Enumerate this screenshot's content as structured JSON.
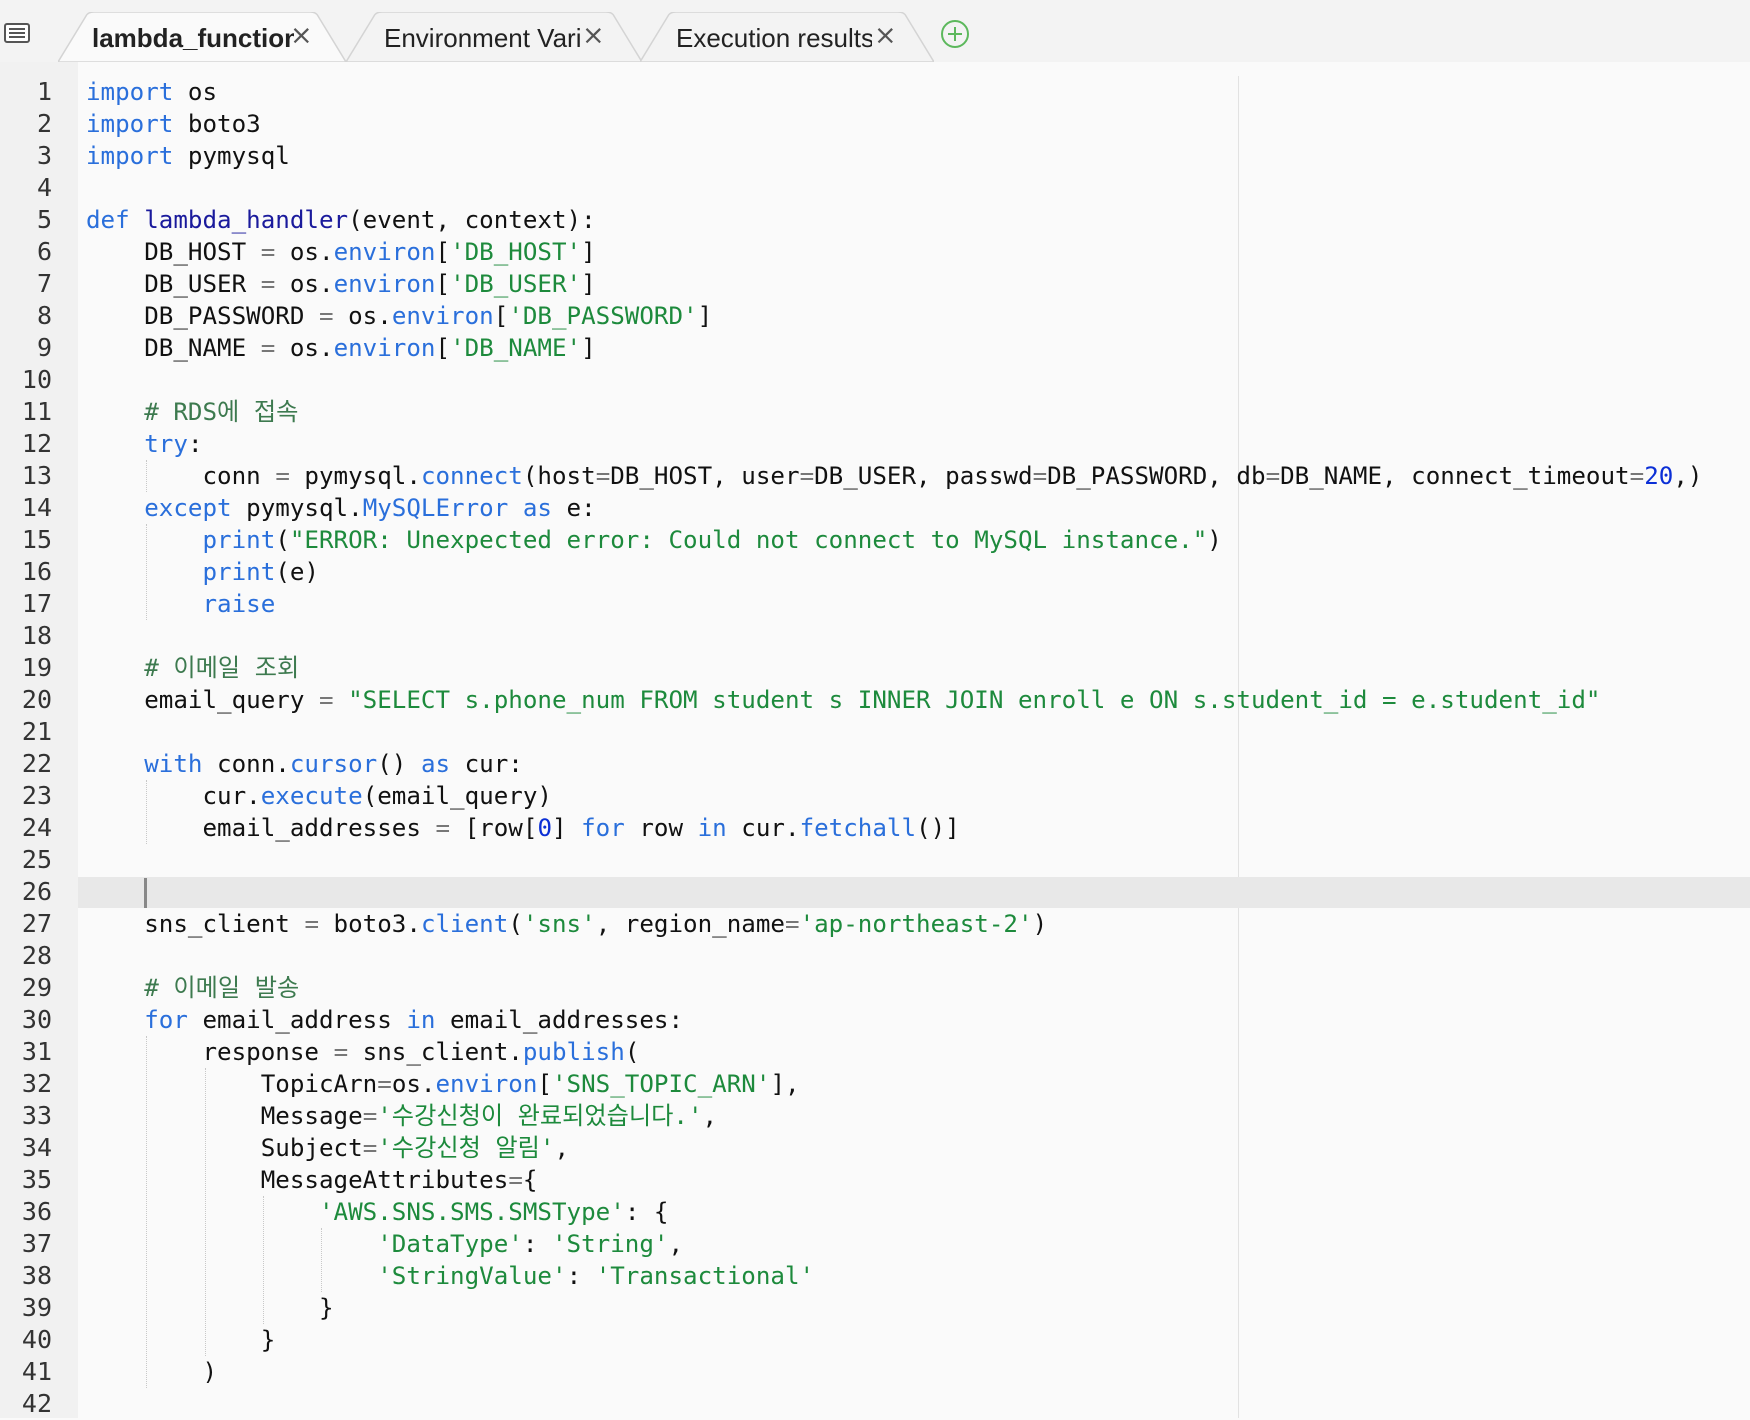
{
  "tabs": [
    {
      "label": "lambda_function",
      "active": true
    },
    {
      "label": "Environment Vari",
      "active": false
    },
    {
      "label": "Execution results",
      "active": false
    }
  ],
  "icons": {
    "menu": "list-menu-icon",
    "close": "close-icon",
    "add_tab": "plus-circle-icon"
  },
  "colors": {
    "keyword": "#2a6fdb",
    "function": "#1a1a9c",
    "string": "#1d8a3c",
    "comment": "#3d7a4f",
    "number": "#0b2fd6",
    "add_tab": "#5cb85c"
  },
  "editor": {
    "language": "python",
    "active_line": 26,
    "line_numbers": [
      "1",
      "2",
      "3",
      "4",
      "5",
      "6",
      "7",
      "8",
      "9",
      "10",
      "11",
      "12",
      "13",
      "14",
      "15",
      "16",
      "17",
      "18",
      "19",
      "20",
      "21",
      "22",
      "23",
      "24",
      "25",
      "26",
      "27",
      "28",
      "29",
      "30",
      "31",
      "32",
      "33",
      "34",
      "35",
      "36",
      "37",
      "38",
      "39",
      "40",
      "41",
      "42"
    ],
    "lines": [
      "import os",
      "import boto3",
      "import pymysql",
      "",
      "def lambda_handler(event, context):",
      "    DB_HOST = os.environ['DB_HOST']",
      "    DB_USER = os.environ['DB_USER']",
      "    DB_PASSWORD = os.environ['DB_PASSWORD']",
      "    DB_NAME = os.environ['DB_NAME']",
      "",
      "    # RDS에 접속",
      "    try:",
      "        conn = pymysql.connect(host=DB_HOST, user=DB_USER, passwd=DB_PASSWORD, db=DB_NAME, connect_timeout=20,)",
      "    except pymysql.MySQLError as e:",
      "        print(\"ERROR: Unexpected error: Could not connect to MySQL instance.\")",
      "        print(e)",
      "        raise",
      "",
      "    # 이메일 조회",
      "    email_query = \"SELECT s.phone_num FROM student s INNER JOIN enroll e ON s.student_id = e.student_id\"",
      "",
      "    with conn.cursor() as cur:",
      "        cur.execute(email_query)",
      "        email_addresses = [row[0] for row in cur.fetchall()]",
      "",
      "    ",
      "    sns_client = boto3.client('sns', region_name='ap-northeast-2')",
      "",
      "    # 이메일 발송",
      "    for email_address in email_addresses:",
      "        response = sns_client.publish(",
      "            TopicArn=os.environ['SNS_TOPIC_ARN'],",
      "            Message='수강신청이 완료되었습니다.',",
      "            Subject='수강신청 알림',",
      "            MessageAttributes={",
      "                'AWS.SNS.SMS.SMSType': {",
      "                    'DataType': 'String',",
      "                    'StringValue': 'Transactional'",
      "                }",
      "            }",
      "        )",
      ""
    ]
  }
}
